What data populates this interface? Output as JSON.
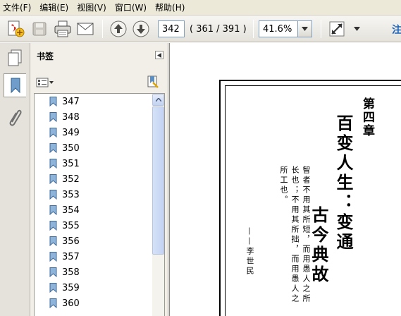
{
  "menu": {
    "items": [
      "文件(F)",
      "编辑(E)",
      "视图(V)",
      "窗口(W)",
      "帮助(H)"
    ]
  },
  "toolbar": {
    "page_value": "342",
    "page_count": "( 361 / 391 )",
    "zoom_value": "41.6%",
    "note_text": "注",
    "icons": [
      "create-pdf-icon",
      "save-icon",
      "print-icon",
      "email-icon",
      "prev-page-icon",
      "next-page-icon",
      "fit-page-icon",
      "toolbar-menu-arrow-icon"
    ]
  },
  "nav": {
    "icons": [
      "pages-icon",
      "bookmarks-icon",
      "attachments-icon"
    ]
  },
  "bookmarks": {
    "title": "书签",
    "items": [
      "347",
      "348",
      "349",
      "350",
      "351",
      "352",
      "353",
      "354",
      "355",
      "356",
      "357",
      "358",
      "359",
      "360"
    ]
  },
  "document": {
    "chapter": "第四章",
    "title_line1": "百变人生：变通",
    "title_line2": "古今典故",
    "quote_lines": [
      "智者不用其所短，而用愚人之所",
      "长也；不用其所拙，而用愚人之",
      "所工也。"
    ],
    "author": "——李世民"
  }
}
